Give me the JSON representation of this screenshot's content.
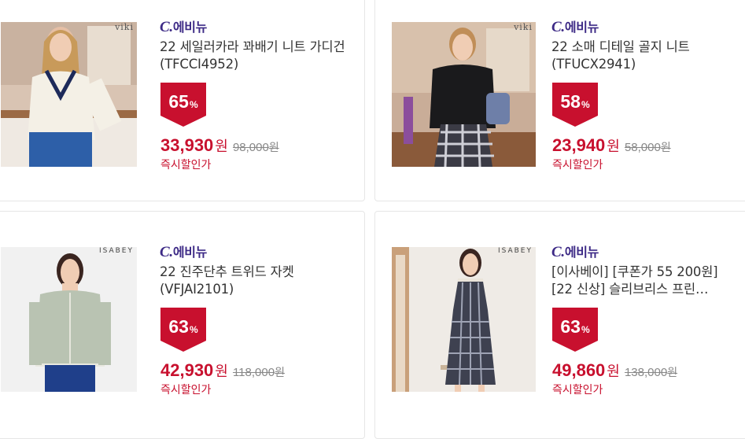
{
  "products": [
    {
      "seller_c": "C.",
      "seller_name": "에비뉴",
      "title": "22 세일러카라 꽈배기 니트 가디건 (TFCCI4952)",
      "discount": "65",
      "discount_unit": "%",
      "price": "33,930",
      "price_unit": "원",
      "original_price": "98,000",
      "original_unit": "원",
      "tag": "즉시할인가",
      "brand_mark": "viki"
    },
    {
      "seller_c": "C.",
      "seller_name": "에비뉴",
      "title": "22 소매 디테일 골지 니트 (TFUCX2941)",
      "discount": "58",
      "discount_unit": "%",
      "price": "23,940",
      "price_unit": "원",
      "original_price": "58,000",
      "original_unit": "원",
      "tag": "즉시할인가",
      "brand_mark": "viki"
    },
    {
      "seller_c": "C.",
      "seller_name": "에비뉴",
      "title": "22 진주단추 트위드 자켓 (VFJAI2101)",
      "discount": "63",
      "discount_unit": "%",
      "price": "42,930",
      "price_unit": "원",
      "original_price": "118,000",
      "original_unit": "원",
      "tag": "즉시할인가",
      "brand_mark": "ISABEY"
    },
    {
      "seller_c": "C.",
      "seller_name": "에비뉴",
      "title": "[이사베이] [쿠폰가 55 200원] [22 신상] 슬리브리스 프린…",
      "discount": "63",
      "discount_unit": "%",
      "price": "49,860",
      "price_unit": "원",
      "original_price": "138,000",
      "original_unit": "원",
      "tag": "즉시할인가",
      "brand_mark": "ISABEY"
    }
  ],
  "colors": {
    "accent": "#c8102e",
    "seller": "#3d2a86",
    "border": "#e6e6e6"
  }
}
